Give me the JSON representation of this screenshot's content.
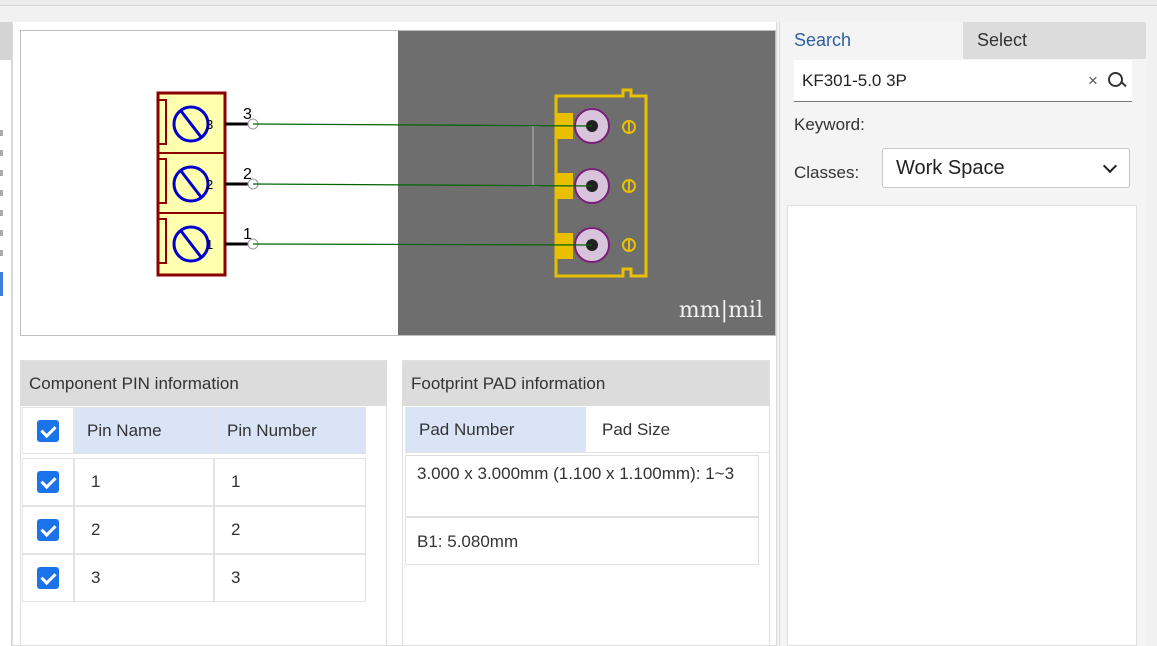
{
  "sidebar_tabs": {
    "search": "Search",
    "select": "Select"
  },
  "search": {
    "value": "KF301-5.0 3P",
    "clear": "×"
  },
  "filters": {
    "keyword_label": "Keyword:",
    "classes_label": "Classes:",
    "classes_value": "Work Space"
  },
  "preview": {
    "units": {
      "mm": "mm",
      "sep": "|",
      "mil": "mil"
    },
    "symbol_pins": [
      "3",
      "2",
      "1"
    ],
    "colors": {
      "symbol_body": "#ffffb0",
      "symbol_outline": "#8b0000",
      "connector": "#0000cc",
      "net_line": "#006400",
      "pcb_bg": "#6e6e6e",
      "pad": "#e8c000",
      "drill": "#d9c4de"
    }
  },
  "pin_panel": {
    "title": "Component PIN information",
    "headers": {
      "name": "Pin Name",
      "number": "Pin Number"
    },
    "rows": [
      {
        "name": "1",
        "number": "1"
      },
      {
        "name": "2",
        "number": "2"
      },
      {
        "name": "3",
        "number": "3"
      }
    ]
  },
  "pad_panel": {
    "title": "Footprint PAD information",
    "headers": {
      "number": "Pad Number",
      "size": "Pad Size"
    },
    "rows": [
      "3.000 x 3.000mm (1.100 x 1.100mm): 1~3",
      "B1: 5.080mm"
    ]
  }
}
